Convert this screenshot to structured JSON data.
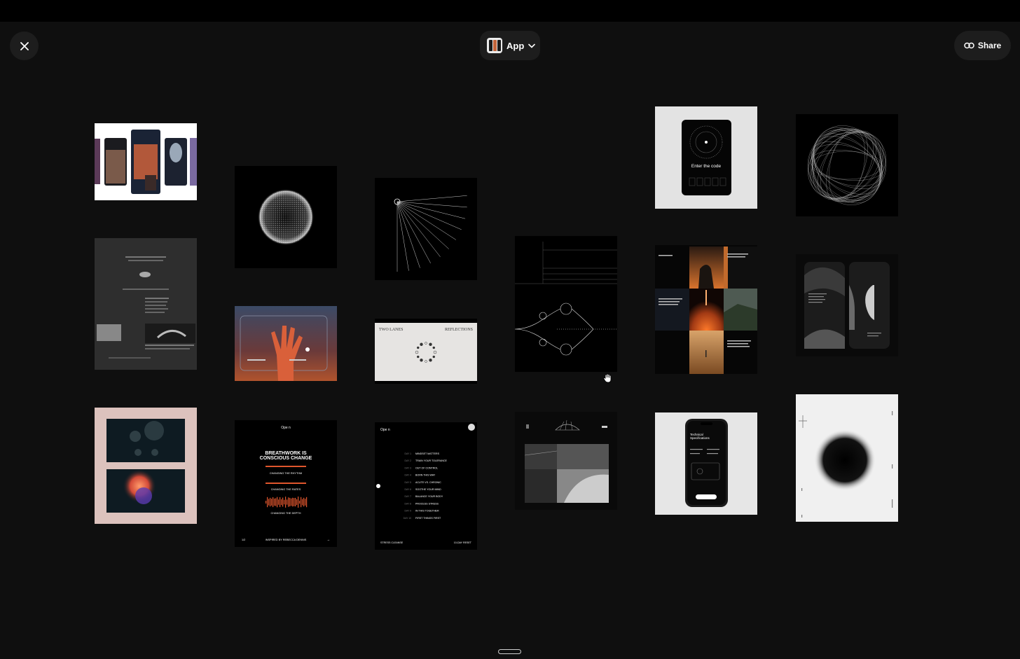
{
  "toolbar": {
    "switcher_label": "App",
    "share_label": "Share"
  },
  "tiles": {
    "code": {
      "title": "Enter the code"
    },
    "two_lanes": {
      "left": "TWO LANES",
      "right": "REFLECTIONS"
    },
    "breathwork": {
      "brand": "Ope n",
      "title_line1": "BREATHWORK IS",
      "title_line2": "CONSCIOUS CHANGE",
      "caption1": "CHANGING THE RHYTHM",
      "caption2": "CHANGING THE RATES",
      "caption3": "CHANGING THE DEPTH",
      "footer_left": "1/2",
      "footer_center": "INSPIRED BY REBECCA DENNIS",
      "footer_right": "→"
    },
    "program": {
      "brand": "Ope n",
      "days": [
        {
          "day": "DAY 1",
          "title": "MINDSET MATTERS"
        },
        {
          "day": "DAY 2",
          "title": "TRAIN YOUR TOLERANCE"
        },
        {
          "day": "DAY 3",
          "title": "OUT OF CONTROL"
        },
        {
          "day": "DAY 4",
          "title": "BORN THIS WAY"
        },
        {
          "day": "DAY 5",
          "title": "ACUTE VS. CHRONIC"
        },
        {
          "day": "DAY 6",
          "title": "SOOTHE YOUR MIND"
        },
        {
          "day": "DAY 7",
          "title": "BALANCE YOUR BODY"
        },
        {
          "day": "DAY 8",
          "title": "PROCESS STRESS"
        },
        {
          "day": "DAY 9",
          "title": "IN THIS TOGETHER"
        },
        {
          "day": "DAY 10",
          "title": "FIRST THINGS FIRST"
        }
      ],
      "footer_left": "STRESS CLEANSE",
      "footer_right": "10-DAY RESET"
    },
    "phone": {
      "title_line1": "Technical",
      "title_line2": "Specifications"
    }
  },
  "colors": {
    "background": "#0f0f0f",
    "topbar": "#000000",
    "button_bg": "#1d1d1d",
    "accent_orange": "#e0562d"
  }
}
